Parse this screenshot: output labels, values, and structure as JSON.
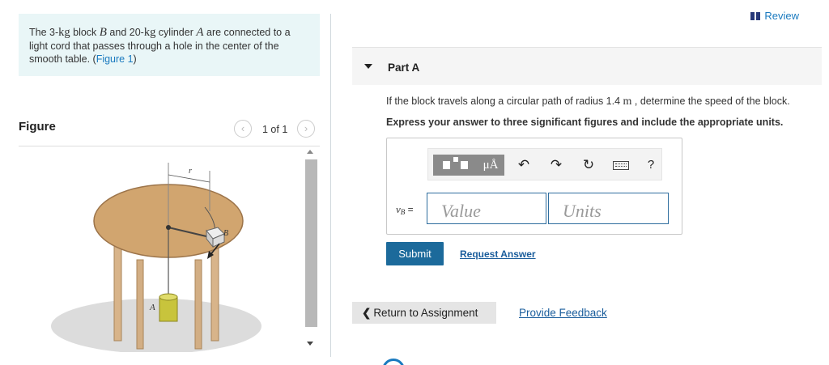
{
  "problem": {
    "text_1": "The 3-",
    "unit_kg_1": "kg",
    "text_2": " block ",
    "var_B": "B",
    "text_3": " and 20-",
    "unit_kg_2": "kg",
    "text_4": " cylinder ",
    "var_A": "A",
    "text_5": " are connected to a light cord that passes through a hole in the center of the smooth table. (",
    "figure_link": "Figure 1",
    "text_6": ")"
  },
  "figure": {
    "title": "Figure",
    "pager_text": "1 of 1",
    "prev_icon": "chevron-left-icon",
    "next_icon": "chevron-right-icon",
    "labels": {
      "r": "r",
      "B": "B",
      "A": "A"
    }
  },
  "header": {
    "review_label": "Review",
    "review_icon": "book-icon"
  },
  "part": {
    "label": "Part A",
    "caret_icon": "caret-down-icon"
  },
  "question": {
    "prefix": "If the block travels along a circular path of radius 1.4 ",
    "unit": "m",
    "suffix": " , determine the speed of the block."
  },
  "instruction": "Express your answer to three significant figures and include the appropriate units.",
  "toolbar": {
    "units_symbol": "μÅ",
    "undo_symbol": "↶",
    "redo_symbol": "↷",
    "reset_symbol": "↻",
    "help_symbol": "?"
  },
  "answer": {
    "var": "v",
    "sub": "B",
    "equals": " =",
    "value_placeholder": "Value",
    "units_placeholder": "Units"
  },
  "actions": {
    "submit": "Submit",
    "request_answer": "Request Answer",
    "return_label": "Return to Assignment",
    "return_icon": "chevron-left-icon",
    "feedback": "Provide Feedback"
  },
  "colors": {
    "accent": "#1c6a9b",
    "link": "#1a7abf",
    "problem_bg": "#e9f6f7"
  }
}
